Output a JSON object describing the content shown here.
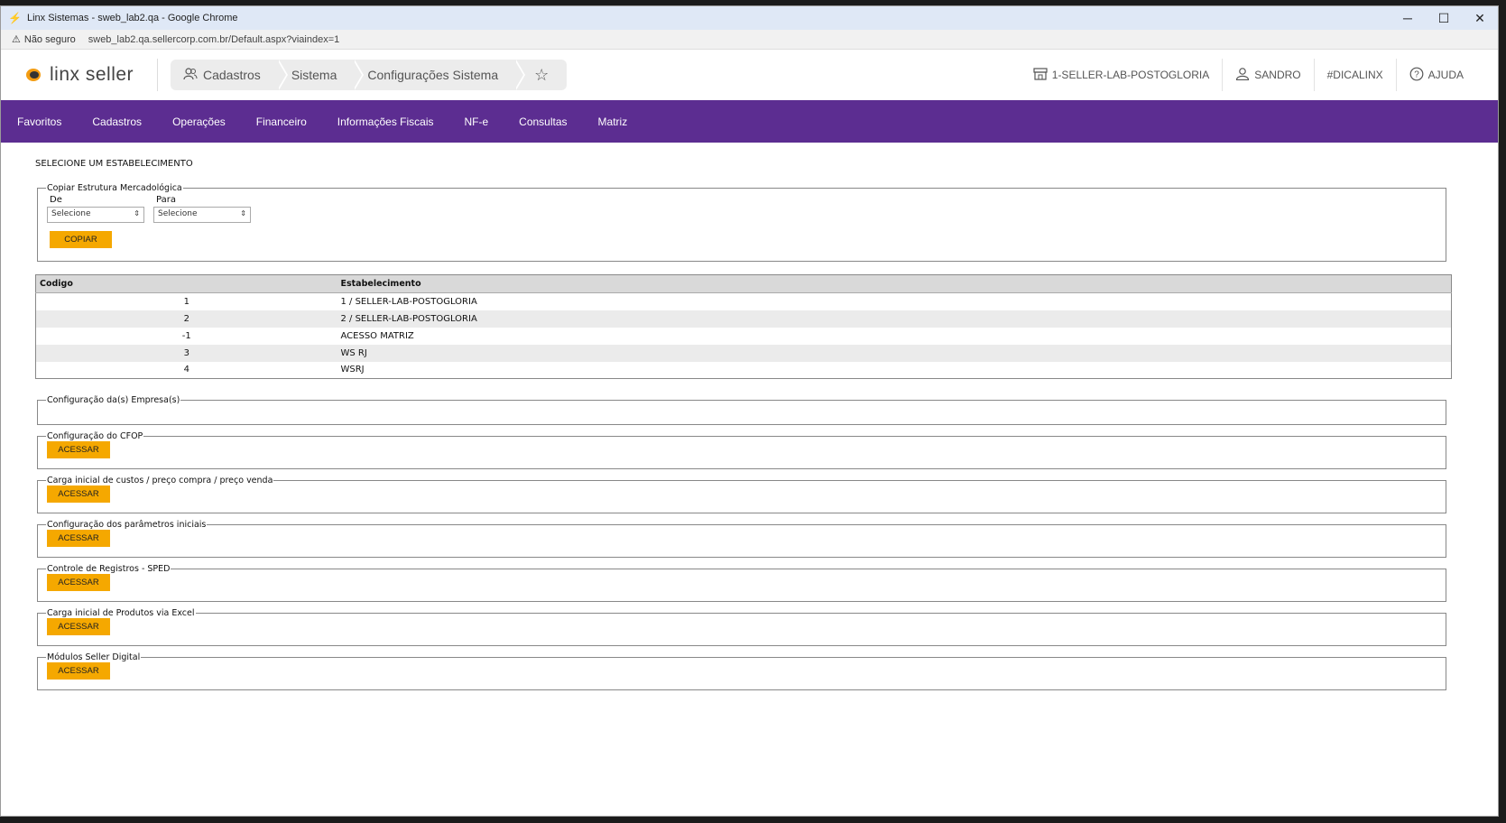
{
  "window": {
    "title": "Linx Sistemas - sweb_lab2.qa - Google Chrome",
    "minimize": "─",
    "maximize": "☐",
    "close": "✕"
  },
  "address": {
    "security": "Não seguro",
    "url": "sweb_lab2.qa.sellercorp.com.br/Default.aspx?viaindex=1"
  },
  "header": {
    "logo_text": "linx seller",
    "breadcrumbs": [
      "Cadastros",
      "Sistema",
      "Configurações Sistema"
    ],
    "store": "1-SELLER-LAB-POSTOGLORIA",
    "user": "SANDRO",
    "tag": "#DICALINX",
    "help": "AJUDA"
  },
  "menu": [
    "Favoritos",
    "Cadastros",
    "Operações",
    "Financeiro",
    "Informações Fiscais",
    "NF-e",
    "Consultas",
    "Matriz"
  ],
  "page": {
    "title": "SELECIONE UM ESTABELECIMENTO"
  },
  "copy_section": {
    "legend": "Copiar Estrutura Mercadológica",
    "from_label": "De",
    "to_label": "Para",
    "from_value": "Selecione",
    "to_value": "Selecione",
    "button": "COPIAR"
  },
  "table": {
    "headers": [
      "Codigo",
      "Estabelecimento"
    ],
    "rows": [
      {
        "code": "1",
        "name": "1 / SELLER-LAB-POSTOGLORIA"
      },
      {
        "code": "2",
        "name": "2 / SELLER-LAB-POSTOGLORIA"
      },
      {
        "code": "-1",
        "name": "ACESSO MATRIZ"
      },
      {
        "code": "3",
        "name": "WS RJ"
      },
      {
        "code": "4",
        "name": "WSRJ"
      }
    ]
  },
  "sections": [
    {
      "legend": "Configuração da(s) Empresa(s)",
      "button": ""
    },
    {
      "legend": "Configuração do CFOP",
      "button": "ACESSAR"
    },
    {
      "legend": "Carga inicial de custos / preço compra / preço venda",
      "button": "ACESSAR"
    },
    {
      "legend": "Configuração dos parâmetros iniciais",
      "button": "ACESSAR"
    },
    {
      "legend": "Controle de Registros - SPED",
      "button": "ACESSAR"
    },
    {
      "legend": "Carga inicial de Produtos via Excel",
      "button": "ACESSAR"
    },
    {
      "legend": "Módulos Seller Digital",
      "button": "ACESSAR"
    }
  ],
  "colors": {
    "menu_bg": "#5c2d91",
    "button_bg": "#f5a800"
  }
}
